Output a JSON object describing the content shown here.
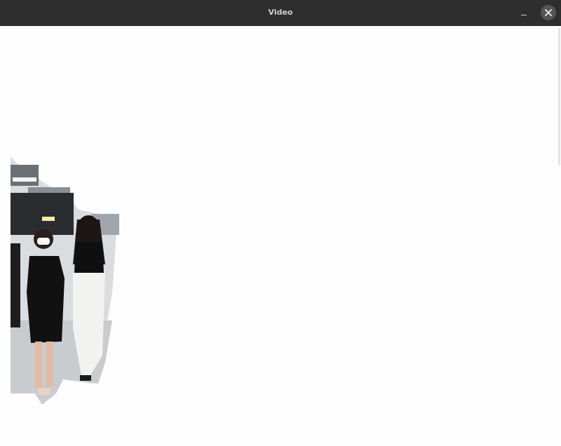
{
  "window": {
    "title": "Video"
  },
  "controls": {
    "minimize_icon": "minimize-icon",
    "close_icon": "close-icon"
  },
  "colors": {
    "titlebar": "#2e2e2e",
    "title_text": "#cfcfcf",
    "close_button_bg": "#555555",
    "canvas_bg": "#fdfdfd"
  }
}
